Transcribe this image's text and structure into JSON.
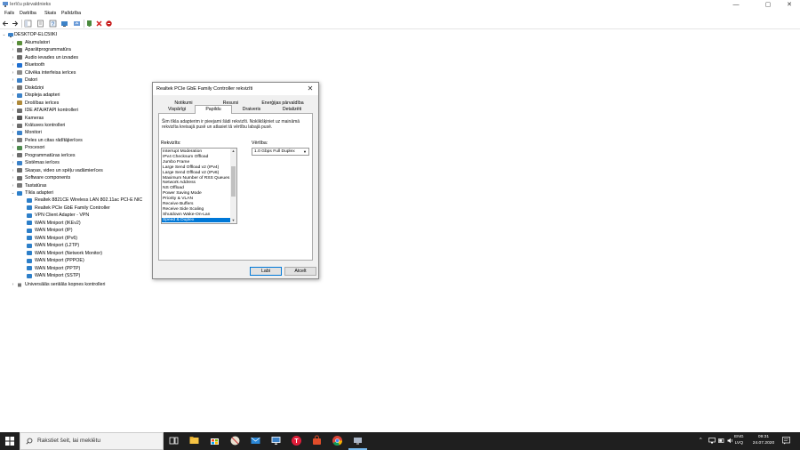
{
  "window": {
    "title": "Ierīču pārvaldnieks",
    "controls": {
      "minimize": "—",
      "maximize": "▢",
      "close": "✕"
    }
  },
  "menu": [
    "Fails",
    "Darbība",
    "Skats",
    "Palīdzība"
  ],
  "tree": {
    "root": "DESKTOP-ELC5IIKI",
    "categories": [
      {
        "label": "Akumulatori",
        "color": "#5a8f3a"
      },
      {
        "label": "Aparātprogrammatūra",
        "color": "#6d6d6d"
      },
      {
        "label": "Audio ievades un izvades",
        "color": "#6b6b6b"
      },
      {
        "label": "Bluetooth",
        "color": "#1f6fd1"
      },
      {
        "label": "Cilvēka interfeisa ierīces",
        "color": "#8a8a8a"
      },
      {
        "label": "Datori",
        "color": "#3c82c8"
      },
      {
        "label": "Diskdziņi",
        "color": "#777777"
      },
      {
        "label": "Displeja adapteri",
        "color": "#3c82c8"
      },
      {
        "label": "Drošības ierīces",
        "color": "#b08a3a"
      },
      {
        "label": "IDE ATA/ATAPI kontrolleri",
        "color": "#6d6d6d"
      },
      {
        "label": "Kameras",
        "color": "#555555"
      },
      {
        "label": "Krātuves kontrolleri",
        "color": "#6d6d6d"
      },
      {
        "label": "Monitori",
        "color": "#3c82c8"
      },
      {
        "label": "Peles un citas rādītājierīces",
        "color": "#777777"
      },
      {
        "label": "Procesori",
        "color": "#4d8a4d"
      },
      {
        "label": "Programmatūras ierīces",
        "color": "#6d6d6d"
      },
      {
        "label": "Sistēmas ierīces",
        "color": "#3c82c8"
      },
      {
        "label": "Skaņas, video un spēļu vadāmierīces",
        "color": "#6b6b6b"
      },
      {
        "label": "Software components",
        "color": "#6d6d6d"
      },
      {
        "label": "Tastatūras",
        "color": "#777777"
      },
      {
        "label": "Tīkla adapteri",
        "color": "#2d7fc9"
      }
    ],
    "network_adapters": [
      "Realtek 8821CE Wireless LAN 802.11ac PCI-E NIC",
      "Realtek PCIe GbE Family Controller",
      "VPN Client Adapter - VPN",
      "WAN Miniport (IKEv2)",
      "WAN Miniport (IP)",
      "WAN Miniport (IPv6)",
      "WAN Miniport (L2TP)",
      "WAN Miniport (Network Monitor)",
      "WAN Miniport (PPPOE)",
      "WAN Miniport (PPTP)",
      "WAN Miniport (SSTP)"
    ],
    "last": "Universālās seriālās kopnes kontrolleri"
  },
  "dialog": {
    "title": "Realtek PCIe GbE Family Controller rekvizīti",
    "tabs_row1": [
      "Notikumi",
      "Resursi",
      "Enerģijas pārvaldība"
    ],
    "tabs_row2": [
      "Vispārīgi",
      "Papildu",
      "Draiveris",
      "Detalizēti"
    ],
    "active_tab": "Papildu",
    "description": "Šim tīkla adapterim ir pieejami šādi rekvizīti. Noklikšķiniet uz maināmā rekvizīta kreisajā pusē un atlasiet tā vērtību labajā pusē.",
    "property_label": "Rekvizīts:",
    "value_label": "Vērtība:",
    "properties": [
      "Interrupt Moderation",
      "IPv4 Checksum Offload",
      "Jumbo Frame",
      "Large Send Offload v2 (IPv4)",
      "Large Send Offload v2 (IPv6)",
      "Maximum Number of RSS Queues",
      "Network Address",
      "NS Offload",
      "Power Saving Mode",
      "Priority & VLAN",
      "Receive Buffers",
      "Receive Side Scaling",
      "Shutdown Wake-On-Lan",
      "Speed & Duplex"
    ],
    "selected_property": "Speed & Duplex",
    "value": "1.0 Gbps Full Duplex",
    "ok": "Labi",
    "cancel": "Atcelt"
  },
  "taskbar": {
    "search_placeholder": "Rakstiet šeit, lai meklētu",
    "lang_top": "ENG",
    "lang_bottom": "LVQ",
    "time": "09:31",
    "date": "24.07.2020",
    "colors": {
      "accent": "#76b9ed",
      "selection": "#0078d7"
    }
  }
}
